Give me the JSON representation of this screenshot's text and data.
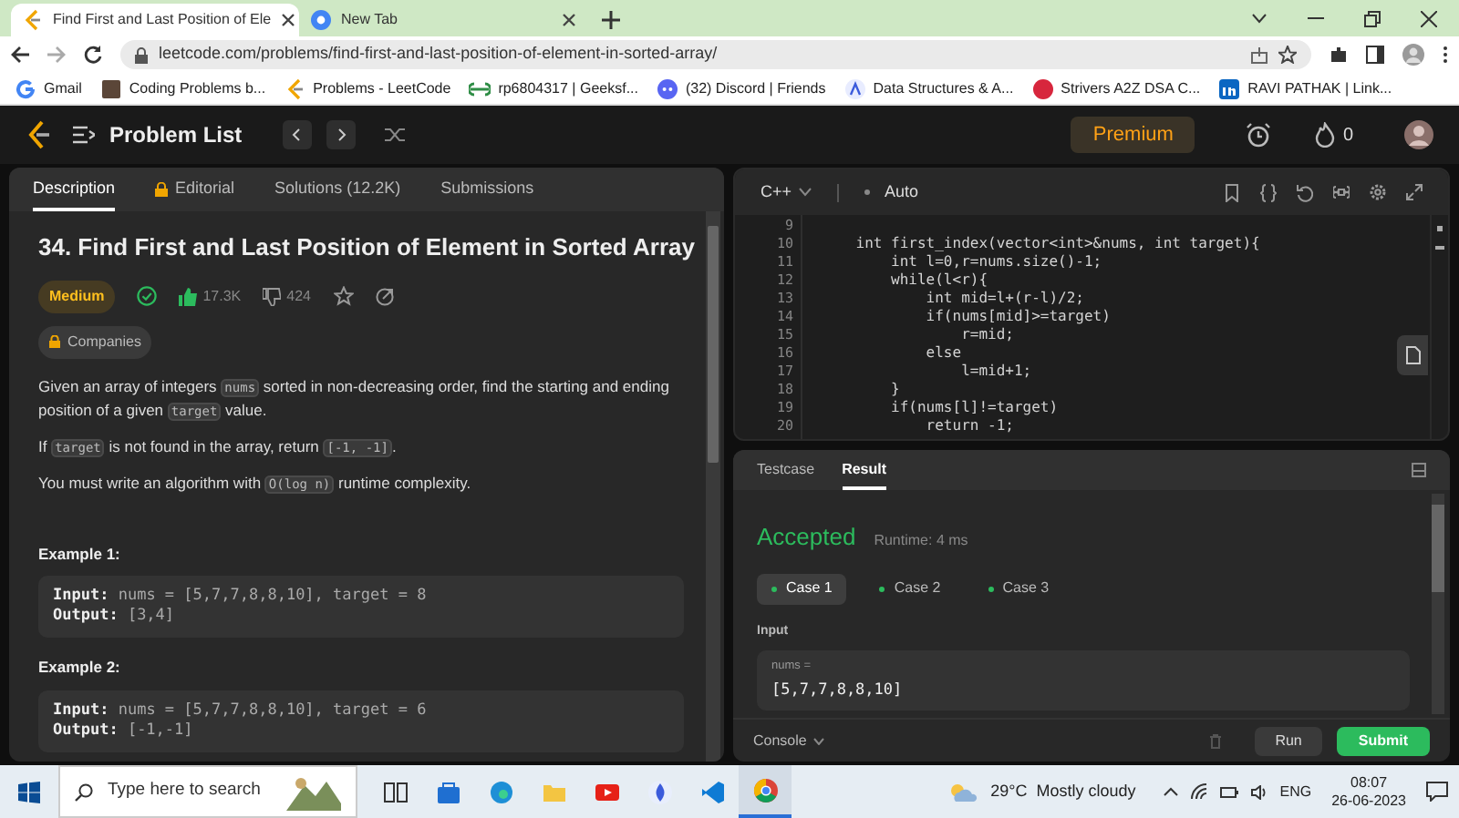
{
  "browser": {
    "tabs": [
      {
        "title": "Find First and Last Position of Ele",
        "selected": true,
        "kind": "leetcode"
      },
      {
        "title": "New Tab",
        "selected": false,
        "kind": "chrome"
      }
    ],
    "url": "leetcode.com/problems/find-first-and-last-position-of-element-in-sorted-array/",
    "bookmarks": [
      {
        "label": "Gmail",
        "kind": "google"
      },
      {
        "label": "Coding Problems b...",
        "kind": "cc"
      },
      {
        "label": "Problems - LeetCode",
        "kind": "leetcode"
      },
      {
        "label": "rp6804317 | Geeksf...",
        "kind": "gfg"
      },
      {
        "label": "(32) Discord | Friends",
        "kind": "discord"
      },
      {
        "label": "Data Structures & A...",
        "kind": "ds"
      },
      {
        "label": "Strivers A2Z DSA C...",
        "kind": "tuf"
      },
      {
        "label": "RAVI PATHAK | Link...",
        "kind": "linkedin"
      }
    ]
  },
  "nav": {
    "title": "Problem List",
    "premium": "Premium",
    "streak": "0"
  },
  "description_tabs": [
    {
      "label": "Description",
      "selected": true,
      "locked": false
    },
    {
      "label": "Editorial",
      "selected": false,
      "locked": true
    },
    {
      "label": "Solutions (12.2K)",
      "selected": false,
      "locked": false
    },
    {
      "label": "Submissions",
      "selected": false,
      "locked": false
    }
  ],
  "problem": {
    "title": "34. Find First and Last Position of Element in Sorted Array",
    "difficulty": "Medium",
    "likes": "17.3K",
    "dislikes": "424",
    "companies": "Companies",
    "paragraphs": [
      [
        {
          "text": "Given an array of integers ",
          "code": false
        },
        {
          "text": "nums",
          "code": true
        },
        {
          "text": " sorted in non-decreasing order, find the starting and ending position of a given ",
          "code": false
        },
        {
          "text": "target",
          "code": true
        },
        {
          "text": " value.",
          "code": false
        }
      ],
      [
        {
          "text": "If ",
          "code": false
        },
        {
          "text": "target",
          "code": true
        },
        {
          "text": " is not found in the array, return ",
          "code": false
        },
        {
          "text": "[-1, -1]",
          "code": true
        },
        {
          "text": ".",
          "code": false
        }
      ],
      [
        {
          "text": "You must write an algorithm with ",
          "code": false
        },
        {
          "text": "O(log n)",
          "code": true
        },
        {
          "text": " runtime complexity.",
          "code": false
        }
      ]
    ],
    "examples": [
      {
        "title": "Example 1:",
        "lines": [
          {
            "label": "Input:",
            "value": "nums = [5,7,7,8,8,10], target = 8"
          },
          {
            "label": "Output:",
            "value": "[3,4]"
          }
        ]
      },
      {
        "title": "Example 2:",
        "lines": [
          {
            "label": "Input:",
            "value": "nums = [5,7,7,8,8,10], target = 6"
          },
          {
            "label": "Output:",
            "value": "[-1,-1]"
          }
        ]
      }
    ]
  },
  "editor": {
    "language": "C++",
    "mode": "Auto",
    "lines": [
      {
        "no": "9"
      },
      {
        "no": "10",
        "text": "    int first_index(vector<int>&nums, int target){"
      },
      {
        "no": "11",
        "text": "        int l=0,r=nums.size()-1;"
      },
      {
        "no": "12",
        "text": "        while(l<r){"
      },
      {
        "no": "13",
        "text": "            int mid=l+(r-l)/2;"
      },
      {
        "no": "14",
        "text": "            if(nums[mid]>=target)"
      },
      {
        "no": "15",
        "text": "                r=mid;"
      },
      {
        "no": "16",
        "text": "            else"
      },
      {
        "no": "17",
        "text": "                l=mid+1;"
      },
      {
        "no": "18",
        "text": "        }"
      },
      {
        "no": "19",
        "text": "        if(nums[l]!=target)"
      },
      {
        "no": "20",
        "text": "            return -1;"
      }
    ]
  },
  "console_tabs": [
    {
      "label": "Testcase",
      "selected": false
    },
    {
      "label": "Result",
      "selected": true
    }
  ],
  "result": {
    "status": "Accepted",
    "runtime": "Runtime: 4 ms",
    "cases": [
      {
        "label": "Case 1",
        "selected": true
      },
      {
        "label": "Case 2",
        "selected": false
      },
      {
        "label": "Case 3",
        "selected": false
      }
    ],
    "input_heading": "Input",
    "input_name": "nums =",
    "input_value": "[5,7,7,8,8,10]"
  },
  "footer": {
    "console": "Console",
    "run": "Run",
    "submit": "Submit"
  },
  "taskbar": {
    "search_placeholder": "Type here to search",
    "apps": [
      {
        "kind": "taskview"
      },
      {
        "kind": "store"
      },
      {
        "kind": "edge"
      },
      {
        "kind": "files"
      },
      {
        "kind": "youtube"
      },
      {
        "kind": "app"
      },
      {
        "kind": "vscode"
      },
      {
        "kind": "chrome"
      }
    ],
    "weather": "29°C  Mostly cloudy",
    "language": "ENG",
    "time": "08:07",
    "date": "26-06-2023"
  }
}
